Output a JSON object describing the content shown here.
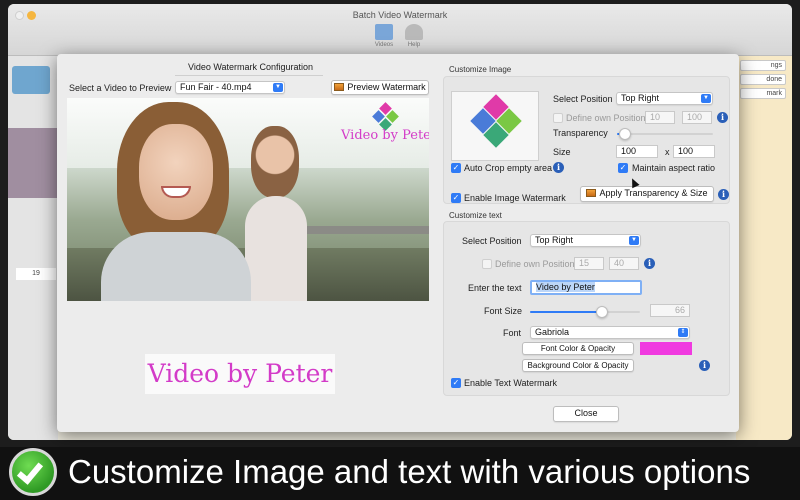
{
  "app": {
    "window_title": "Batch Video Watermark",
    "toolbar": [
      {
        "label": "Videos"
      },
      {
        "label": "Help"
      }
    ],
    "right_buttons": [
      "ngs",
      "done",
      "mark"
    ],
    "left_number": "19"
  },
  "dialog": {
    "title": "Video Watermark Configuration",
    "select_video_label": "Select a Video to Preview",
    "selected_video": "Fun Fair - 40.mp4",
    "preview_button": "Preview Watermark",
    "overlay_text": "Video by Peter",
    "text_sample": "Video by Peter",
    "close_button": "Close"
  },
  "image_section": {
    "title": "Customize Image",
    "position_label": "Select Position",
    "position_value": "Top Right",
    "define_own_label": "Define own Position",
    "define_own_x": "10",
    "define_own_y": "100",
    "transparency_label": "Transparency",
    "transparency_value": 0.08,
    "size_label": "Size",
    "size_w": "100",
    "size_x_label": "x",
    "size_h": "100",
    "auto_crop_label": "Auto Crop empty area",
    "maintain_aspect_label": "Maintain aspect ratio",
    "enable_label": "Enable Image Watermark",
    "apply_button": "Apply Transparency & Size"
  },
  "text_section": {
    "title": "Customize text",
    "position_label": "Select Position",
    "position_value": "Top Right",
    "define_own_label": "Define own Position",
    "define_own_x": "15",
    "define_own_y": "40",
    "enter_text_label": "Enter the text",
    "text_value": "Video by Peter",
    "font_size_label": "Font Size",
    "font_size_value": "66",
    "font_size_level": 0.66,
    "font_label": "Font",
    "font_value": "Gabriola",
    "font_color_button": "Font Color & Opacity",
    "bg_color_button": "Background Color & Opacity",
    "enable_label": "Enable Text Watermark",
    "font_color": "#f03ae0"
  },
  "banner": {
    "text": "Customize Image and text with various options"
  },
  "colors": {
    "accent": "#2f7bf6",
    "watermark_text": "#d33bc8",
    "info": "#2a5fb8"
  }
}
